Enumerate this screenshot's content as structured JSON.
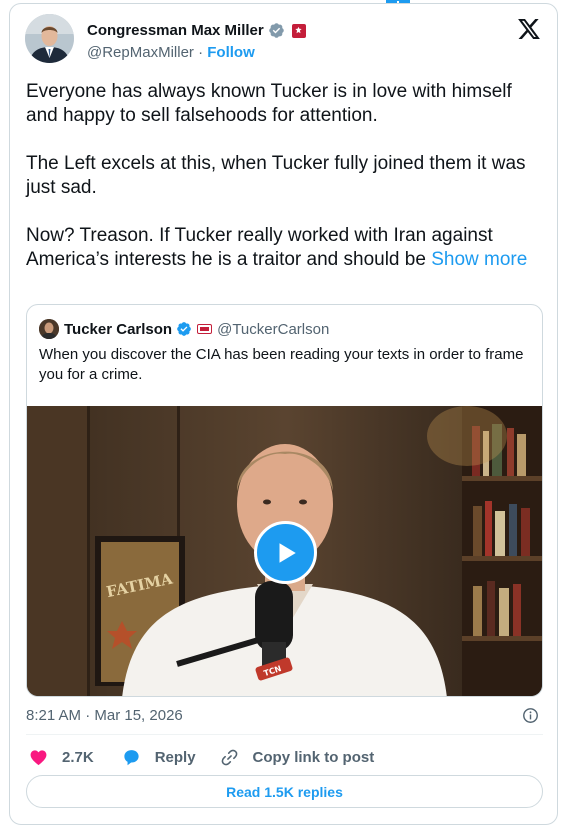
{
  "author": {
    "name": "Congressman Max Miller",
    "handle": "@RepMaxMiller",
    "separator": "·",
    "follow_label": "Follow"
  },
  "tweet": {
    "paragraphs": [
      "Everyone has always known Tucker is in love with himself and happy to sell falsehoods for attention.",
      "The Left excels at this, when Tucker fully joined them it was just sad."
    ],
    "last_paragraph": "Now? Treason. If Tucker really worked with Iran against America’s interests he is a traitor and should be ",
    "show_more_label": "Show more"
  },
  "quote": {
    "name": "Tucker Carlson",
    "handle": "@TuckerCarlson",
    "text": "When you discover the CIA has been reading your texts in order to frame you for a crime.",
    "video": {
      "poster_text": "FATIMA",
      "mic_label": "TCN"
    }
  },
  "timestamp": "8:21 AM · Mar 15, 2026",
  "actions": {
    "like_count": "2.7K",
    "reply_label": "Reply",
    "copy_label": "Copy link to post"
  },
  "read_replies_label": "Read 1.5K replies",
  "icons": [
    "verified-icon",
    "affiliation-badge-icon",
    "x-logo-icon",
    "play-icon",
    "info-icon",
    "heart-icon",
    "reply-icon",
    "link-icon"
  ],
  "colors": {
    "accent": "#1d9bf0",
    "like": "#f91880",
    "text": "#0f1419",
    "secondary": "#536471",
    "border": "#cfd9de"
  }
}
